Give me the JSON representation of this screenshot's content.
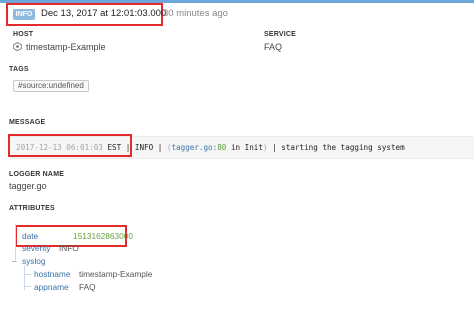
{
  "header": {
    "badge": "INFO",
    "date": "Dec 13, 2017 at 12:01:03.000",
    "relative": "30 minutes ago"
  },
  "host": {
    "label": "HOST",
    "value": "timestamp-Example"
  },
  "service": {
    "label": "SERVICE",
    "value": "FAQ"
  },
  "tags": {
    "label": "TAGS",
    "items": [
      "#source:undefined"
    ]
  },
  "message": {
    "label": "MESSAGE",
    "timestamp": "2017-12-13 06:01:03",
    "tz": "EST",
    "sep1": " | ",
    "level": "INFO",
    "sep2": " | ",
    "open": "(",
    "file": "tagger.go",
    "colon": ":",
    "line": "80",
    "in_text": " in Init",
    "close": ")",
    "sep3": " | ",
    "text": "starting the tagging system"
  },
  "logger": {
    "label": "LOGGER NAME",
    "value": "tagger.go"
  },
  "attributes": {
    "label": "ATTRIBUTES",
    "date_key": "date",
    "date_value": "1513162863000",
    "severity_key": "severity",
    "severity_value": "INFO",
    "syslog_key": "syslog",
    "hostname_key": "hostname",
    "hostname_value": "timestamp-Example",
    "appname_key": "appname",
    "appname_value": "FAQ"
  },
  "colors": {
    "highlight": "#e32b2b",
    "badge": "#8fb9e0",
    "key": "#3b6fa6",
    "number": "#6aa23f"
  }
}
